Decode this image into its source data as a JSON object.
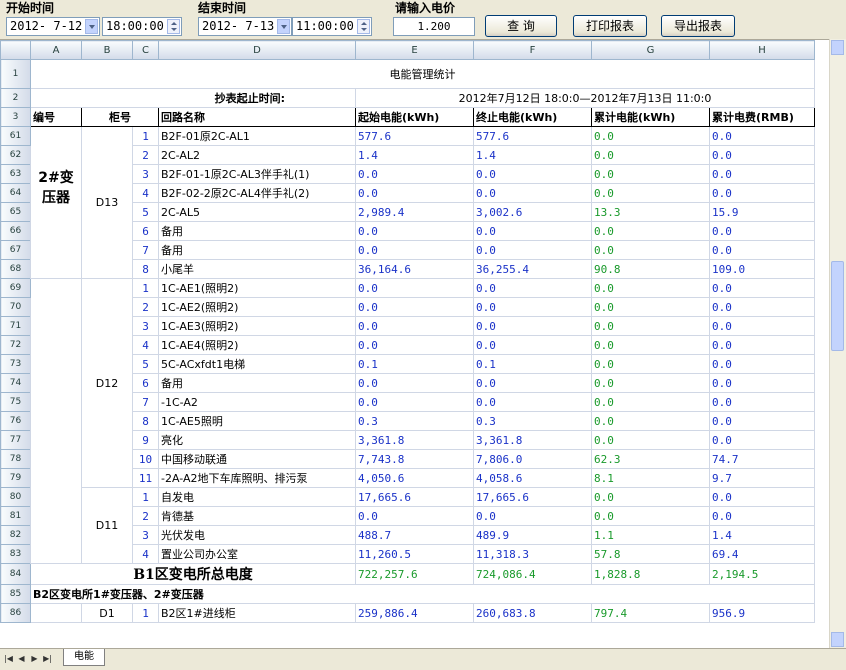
{
  "toolbar": {
    "start_label": "开始时间",
    "start_date": "2012- 7-12",
    "start_time": "18:00:00",
    "end_label": "结束时间",
    "end_date": "2012- 7-13",
    "end_time": "11:00:00",
    "price_label": "请输入电价",
    "price_value": "1.200",
    "query_button": "查 询",
    "print_button": "打印报表",
    "export_button": "导出报表"
  },
  "columns": [
    "A",
    "B",
    "C",
    "D",
    "E",
    "F",
    "G",
    "H"
  ],
  "title": "电能管理统计",
  "period_label": "抄表起止时间:",
  "period_value": "2012年7月12日 18:0:0—2012年7月13日 11:0:0",
  "headers": {
    "id": "编号",
    "cabinet": "柜号",
    "circuit": "回路名称",
    "start_energy": "起始电能(kWh)",
    "end_energy": "终止电能(kWh)",
    "total_energy": "累计电能(kWh)",
    "total_cost": "累计电费(RMB)"
  },
  "transformer_label": "2#变压器",
  "groups": {
    "d13": "D13",
    "d12": "D12",
    "d11": "D11",
    "d1": "D1"
  },
  "rows": [
    {
      "rn": "61",
      "no": "1",
      "name": "B2F-01原2C-AL1",
      "e": "577.6",
      "f": "577.6",
      "g": "0.0",
      "h": "0.0"
    },
    {
      "rn": "62",
      "no": "2",
      "name": "2C-AL2",
      "e": "1.4",
      "f": "1.4",
      "g": "0.0",
      "h": "0.0"
    },
    {
      "rn": "63",
      "no": "3",
      "name": "B2F-01-1原2C-AL3伴手礼(1)",
      "e": "0.0",
      "f": "0.0",
      "g": "0.0",
      "h": "0.0"
    },
    {
      "rn": "64",
      "no": "4",
      "name": "B2F-02-2原2C-AL4伴手礼(2)",
      "e": "0.0",
      "f": "0.0",
      "g": "0.0",
      "h": "0.0"
    },
    {
      "rn": "65",
      "no": "5",
      "name": "2C-AL5",
      "e": "2,989.4",
      "f": "3,002.6",
      "g": "13.3",
      "h": "15.9"
    },
    {
      "rn": "66",
      "no": "6",
      "name": "备用",
      "e": "0.0",
      "f": "0.0",
      "g": "0.0",
      "h": "0.0"
    },
    {
      "rn": "67",
      "no": "7",
      "name": "备用",
      "e": "0.0",
      "f": "0.0",
      "g": "0.0",
      "h": "0.0"
    },
    {
      "rn": "68",
      "no": "8",
      "name": "小尾羊",
      "e": "36,164.6",
      "f": "36,255.4",
      "g": "90.8",
      "h": "109.0"
    },
    {
      "rn": "69",
      "no": "1",
      "name": "1C-AE1(照明2)",
      "e": "0.0",
      "f": "0.0",
      "g": "0.0",
      "h": "0.0"
    },
    {
      "rn": "70",
      "no": "2",
      "name": "1C-AE2(照明2)",
      "e": "0.0",
      "f": "0.0",
      "g": "0.0",
      "h": "0.0"
    },
    {
      "rn": "71",
      "no": "3",
      "name": "1C-AE3(照明2)",
      "e": "0.0",
      "f": "0.0",
      "g": "0.0",
      "h": "0.0"
    },
    {
      "rn": "72",
      "no": "4",
      "name": "1C-AE4(照明2)",
      "e": "0.0",
      "f": "0.0",
      "g": "0.0",
      "h": "0.0"
    },
    {
      "rn": "73",
      "no": "5",
      "name": "5C-ACxfdt1电梯",
      "e": "0.1",
      "f": "0.1",
      "g": "0.0",
      "h": "0.0"
    },
    {
      "rn": "74",
      "no": "6",
      "name": "备用",
      "e": "0.0",
      "f": "0.0",
      "g": "0.0",
      "h": "0.0"
    },
    {
      "rn": "75",
      "no": "7",
      "name": "-1C-A2",
      "e": "0.0",
      "f": "0.0",
      "g": "0.0",
      "h": "0.0"
    },
    {
      "rn": "76",
      "no": "8",
      "name": "1C-AE5照明",
      "e": "0.3",
      "f": "0.3",
      "g": "0.0",
      "h": "0.0"
    },
    {
      "rn": "77",
      "no": "9",
      "name": "亮化",
      "e": "3,361.8",
      "f": "3,361.8",
      "g": "0.0",
      "h": "0.0"
    },
    {
      "rn": "78",
      "no": "10",
      "name": "中国移动联通",
      "e": "7,743.8",
      "f": "7,806.0",
      "g": "62.3",
      "h": "74.7"
    },
    {
      "rn": "79",
      "no": "11",
      "name": "-2A-A2地下车库照明、排污泵",
      "e": "4,050.6",
      "f": "4,058.6",
      "g": "8.1",
      "h": "9.7"
    },
    {
      "rn": "80",
      "no": "1",
      "name": "自发电",
      "e": "17,665.6",
      "f": "17,665.6",
      "g": "0.0",
      "h": "0.0"
    },
    {
      "rn": "81",
      "no": "2",
      "name": "肯德基",
      "e": "0.0",
      "f": "0.0",
      "g": "0.0",
      "h": "0.0"
    },
    {
      "rn": "82",
      "no": "3",
      "name": "光伏发电",
      "e": "488.7",
      "f": "489.9",
      "g": "1.1",
      "h": "1.4"
    },
    {
      "rn": "83",
      "no": "4",
      "name": "置业公司办公室",
      "e": "11,260.5",
      "f": "11,318.3",
      "g": "57.8",
      "h": "69.4"
    }
  ],
  "total_row": {
    "rn": "84",
    "label": "B1区变电所总电度",
    "e": "722,257.6",
    "f": "724,086.4",
    "g": "1,828.8",
    "h": "2,194.5"
  },
  "section_row": {
    "rn": "85",
    "label": "B2区变电所1#变压器、2#变压器"
  },
  "last_row": {
    "rn": "86",
    "no": "1",
    "name": "B2区1#进线柜",
    "e": "259,886.4",
    "f": "260,683.8",
    "g": "797.4",
    "h": "956.9"
  },
  "sheet_tab": "电能"
}
